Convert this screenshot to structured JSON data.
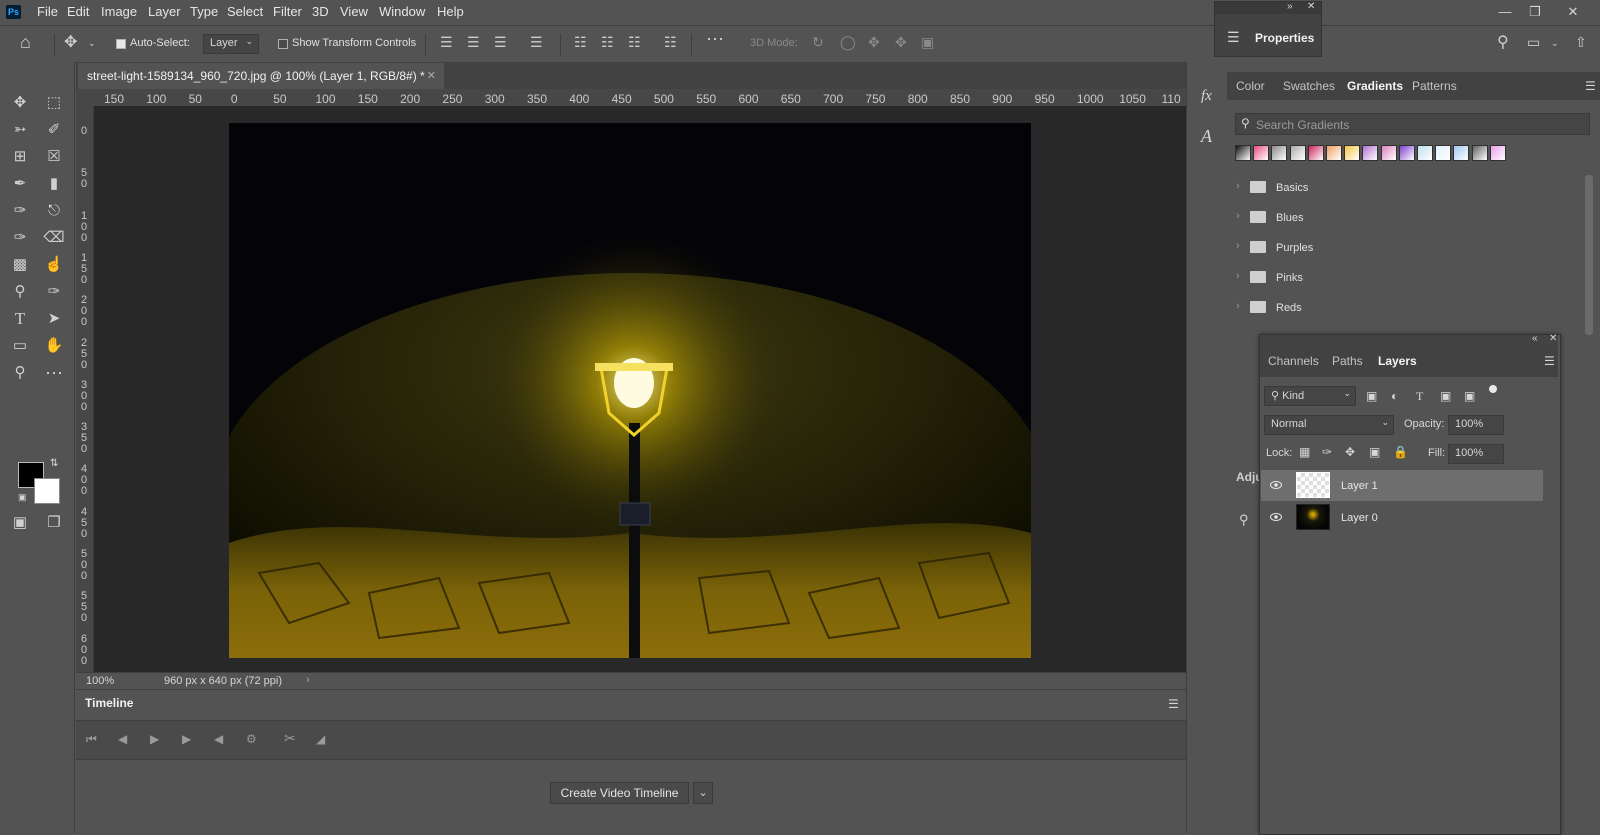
{
  "app": {
    "logo": "Ps"
  },
  "menu": [
    "File",
    "Edit",
    "Image",
    "Layer",
    "Type",
    "Select",
    "Filter",
    "3D",
    "View",
    "Window",
    "Help"
  ],
  "options_bar": {
    "auto_select_label": "Auto-Select:",
    "auto_select_value": "Layer",
    "show_transform_label": "Show Transform Controls",
    "mode_3d_label": "3D Mode:"
  },
  "document": {
    "tab_title": "street-light-1589134_960_720.jpg @ 100% (Layer 1, RGB/8#) *",
    "zoom": "100%",
    "doc_info": "960 px x 640 px (72 ppi)"
  },
  "ruler_top": [
    "150",
    "100",
    "50",
    "0",
    "50",
    "100",
    "150",
    "200",
    "250",
    "300",
    "350",
    "400",
    "450",
    "500",
    "550",
    "600",
    "650",
    "700",
    "750",
    "800",
    "850",
    "900",
    "950",
    "1000",
    "1050",
    "110"
  ],
  "ruler_left": [
    "0",
    "5 0",
    "1 0 0",
    "1 5 0",
    "2 0 0",
    "2 5 0",
    "3 0 0",
    "3 5 0",
    "4 0 0",
    "4 5 0",
    "5 0 0",
    "5 5 0",
    "6 0 0"
  ],
  "timeline": {
    "tab": "Timeline",
    "create_button": "Create Video Timeline"
  },
  "properties": {
    "title": "Properties"
  },
  "gradients_panel": {
    "tabs": [
      "Color",
      "Swatches",
      "Gradients",
      "Patterns"
    ],
    "active_tab": "Gradients",
    "search_placeholder": "Search Gradients",
    "folders": [
      "Basics",
      "Blues",
      "Purples",
      "Pinks",
      "Reds"
    ],
    "swatch_colors": [
      "#111111",
      "#e94a7c",
      "#888888",
      "#aaaaaa",
      "#d0245e",
      "#f0a060",
      "#f5c542",
      "#b070d0",
      "#e080c0",
      "#8040d0",
      "#c0e0f0",
      "#e0f0ff",
      "#a0c8f0",
      "#606060",
      "#e8a0e8"
    ]
  },
  "layers_panel": {
    "tabs": [
      "Channels",
      "Paths",
      "Layers"
    ],
    "active_tab": "Layers",
    "filter_kind": "Kind",
    "blend_mode": "Normal",
    "opacity_label": "Opacity:",
    "opacity_value": "100%",
    "lock_label": "Lock:",
    "fill_label": "Fill:",
    "fill_value": "100%",
    "layers": [
      {
        "name": "Layer 1",
        "selected": true
      },
      {
        "name": "Layer 0",
        "selected": false
      }
    ]
  },
  "adjustments": {
    "label": "Adju"
  }
}
